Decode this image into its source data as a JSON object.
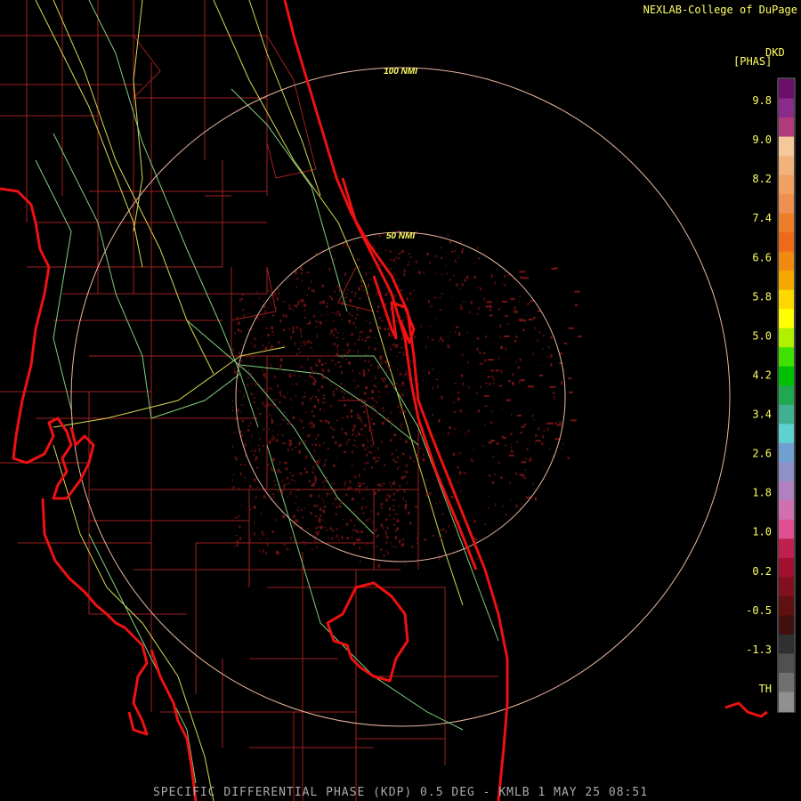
{
  "credit": "NEXLAB-College of DuPage",
  "footer": "SPECIFIC DIFFERENTIAL PHASE (KDP) 0.5 DEG - KMLB 1 MAY 25 08:51",
  "range_rings": [
    {
      "label": "50 NMI"
    },
    {
      "label": "100 NMI"
    }
  ],
  "legend": {
    "unit_top": "DKD",
    "unit_sub": "[PHAS]",
    "tick_labels": [
      "9.8",
      "9.0",
      "8.2",
      "7.4",
      "6.6",
      "5.8",
      "5.0",
      "4.2",
      "3.4",
      "2.6",
      "1.8",
      "1.0",
      "0.2",
      "-0.5",
      "-1.3",
      "TH"
    ],
    "colors": [
      "#6b0f6b",
      "#8a2a8a",
      "#b03a7a",
      "#f5c89a",
      "#f2b27c",
      "#f0a060",
      "#ee9050",
      "#ee7d2a",
      "#ec6a1a",
      "#f08a10",
      "#f4a800",
      "#ffd800",
      "#ffff00",
      "#b0f000",
      "#40e000",
      "#00c000",
      "#20a850",
      "#40b090",
      "#60d0d0",
      "#70a0d0",
      "#9090c8",
      "#b080c0",
      "#d070b0",
      "#e05090",
      "#c02050",
      "#a01030",
      "#801020",
      "#601010",
      "#401010",
      "#303030",
      "#505050",
      "#707070",
      "#909090"
    ],
    "colors_note": "top-to-bottom color bar"
  },
  "colors": {
    "coast": "#ee1111",
    "county": "#aa2222",
    "road_yellow": "#dddd55",
    "road_green": "#88dd88",
    "ring": "#e8b8a0",
    "echo": "#7a1414"
  }
}
